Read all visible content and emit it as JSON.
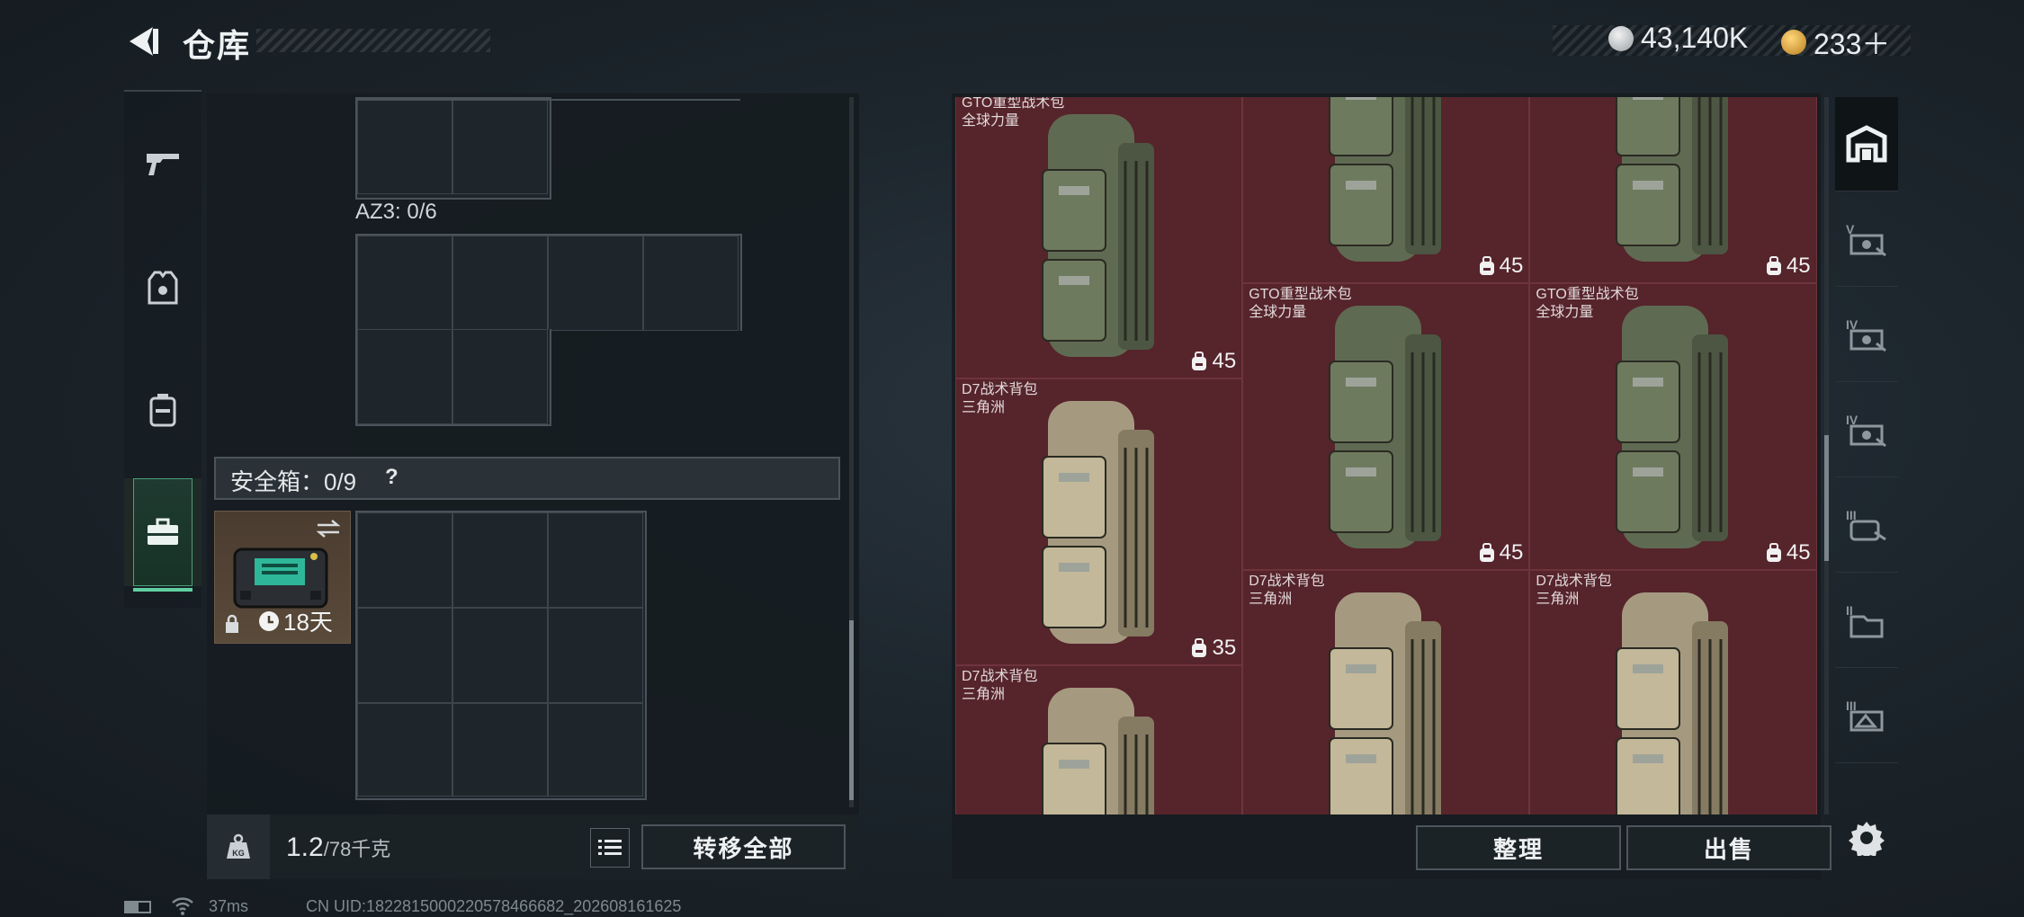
{
  "header": {
    "title": "仓库",
    "currency_primary": "43,140K",
    "currency_secondary": "233＋"
  },
  "left_tabs": [
    "weapon-tab",
    "armor-tab",
    "backpack-tab",
    "safebox-tab"
  ],
  "container": {
    "az3_label": "AZ3: 0/6",
    "safe_label": "安全箱：0/9",
    "help": "?",
    "safebox_timer": "18天"
  },
  "bottom": {
    "weight_value": "1.2",
    "weight_max": "/78千克",
    "transfer_all": "转移全部",
    "sort": "整理",
    "sell": "出售"
  },
  "stash_items": [
    {
      "name": "GTO重型战术包",
      "sub": "全球力量",
      "cap": "45"
    },
    {
      "name": "",
      "sub": "",
      "cap": "45"
    },
    {
      "name": "",
      "sub": "",
      "cap": "45"
    },
    {
      "name": "GTO重型战术包",
      "sub": "全球力量",
      "cap": "45"
    },
    {
      "name": "GTO重型战术包",
      "sub": "全球力量",
      "cap": "45"
    },
    {
      "name": "D7战术背包",
      "sub": "三角洲",
      "cap": "35"
    },
    {
      "name": "D7战术背包",
      "sub": "三角洲",
      "cap": ""
    },
    {
      "name": "D7战术背包",
      "sub": "三角洲",
      "cap": ""
    },
    {
      "name": "D7战术背包",
      "sub": "三角洲",
      "cap": ""
    }
  ],
  "sidebar_right": [
    "all-items",
    "tier-V",
    "tier-IV",
    "tier-IV",
    "tier-III",
    "tier-II",
    "tier-I",
    "settings"
  ],
  "statusbar": {
    "ping": "37ms",
    "uid": "CN UID:1822815000220578466682_202608161625"
  },
  "colors": {
    "stash_bg": "#4a1e24",
    "active_tab": "#5fd0a0"
  }
}
